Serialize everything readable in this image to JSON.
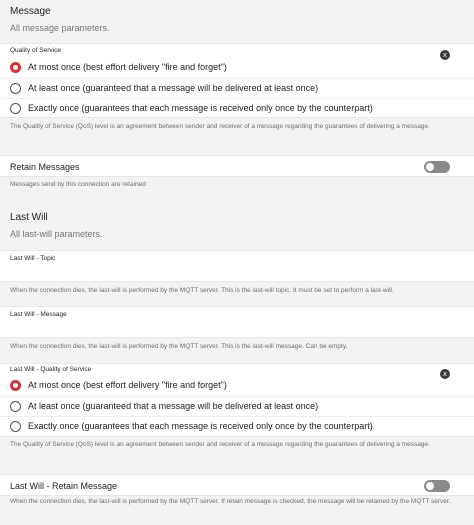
{
  "message_section": {
    "title": "Message",
    "subtitle": "All message parameters.",
    "qos": {
      "label": "Quality of Service",
      "clear_icon": "x",
      "options": [
        {
          "label": "At most once (best effort delivery \"fire and forget\")",
          "checked": true
        },
        {
          "label": "At least once (guaranteed that a message will be delivered at least once)",
          "checked": false
        },
        {
          "label": "Exactly once (guarantees that each message is received only once by the counterpart)",
          "checked": false
        }
      ],
      "description": "The Quality of Service (QoS) level is an agreement between sender and receiver of a message regarding the guarantees of delivering a message."
    },
    "retain": {
      "label": "Retain Messages",
      "on": false,
      "description": "Messages send by this connection are retained"
    }
  },
  "last_will_section": {
    "title": "Last Will",
    "subtitle": "All last-will parameters.",
    "topic": {
      "label": "Last Will - Topic",
      "value": "",
      "description": "When the connection dies, the last-will is performed by the MQTT server. This is the last-will topic. It must be set to perform a last-will."
    },
    "message": {
      "label": "Last Will - Message",
      "value": "",
      "description": "When the connection dies, the last-will is performed by the MQTT server. This is the last-will message. Can be empty."
    },
    "qos": {
      "label": "Last Will - Quality of Service",
      "clear_icon": "x",
      "options": [
        {
          "label": "At most once (best effort delivery \"fire and forget\")",
          "checked": true
        },
        {
          "label": "At least once (guaranteed that a message will be delivered at least once)",
          "checked": false
        },
        {
          "label": "Exactly once (guarantees that each message is received only once by the counterpart)",
          "checked": false
        }
      ],
      "description": "The Quality of Service (QoS) level is an agreement between sender and receiver of a message regarding the guarantees of delivering a message."
    },
    "retain": {
      "label": "Last Will - Retain Message",
      "on": false,
      "description": "When the connection dies, the last-will is performed by the MQTT server. If retain message is checked, the message will be retained by the MQTT server."
    }
  },
  "colors": {
    "radio_checked": "#d13438",
    "toggle_off": "#8a8a8a"
  }
}
